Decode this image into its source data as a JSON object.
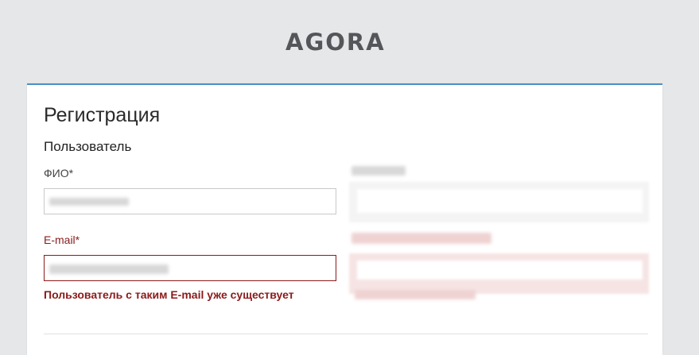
{
  "header": {
    "logo_text": "AGORA"
  },
  "form": {
    "title": "Регистрация",
    "section_title": "Пользователь",
    "fields": {
      "fio": {
        "label": "ФИО*",
        "value": ""
      },
      "email": {
        "label": "E-mail*",
        "value": "",
        "error": "Пользователь с таким E-mail уже существует"
      }
    }
  },
  "colors": {
    "accent": "#4a90c9",
    "error": "#8b1a1a",
    "background": "#e6e7e8",
    "logo": "#54565a"
  }
}
